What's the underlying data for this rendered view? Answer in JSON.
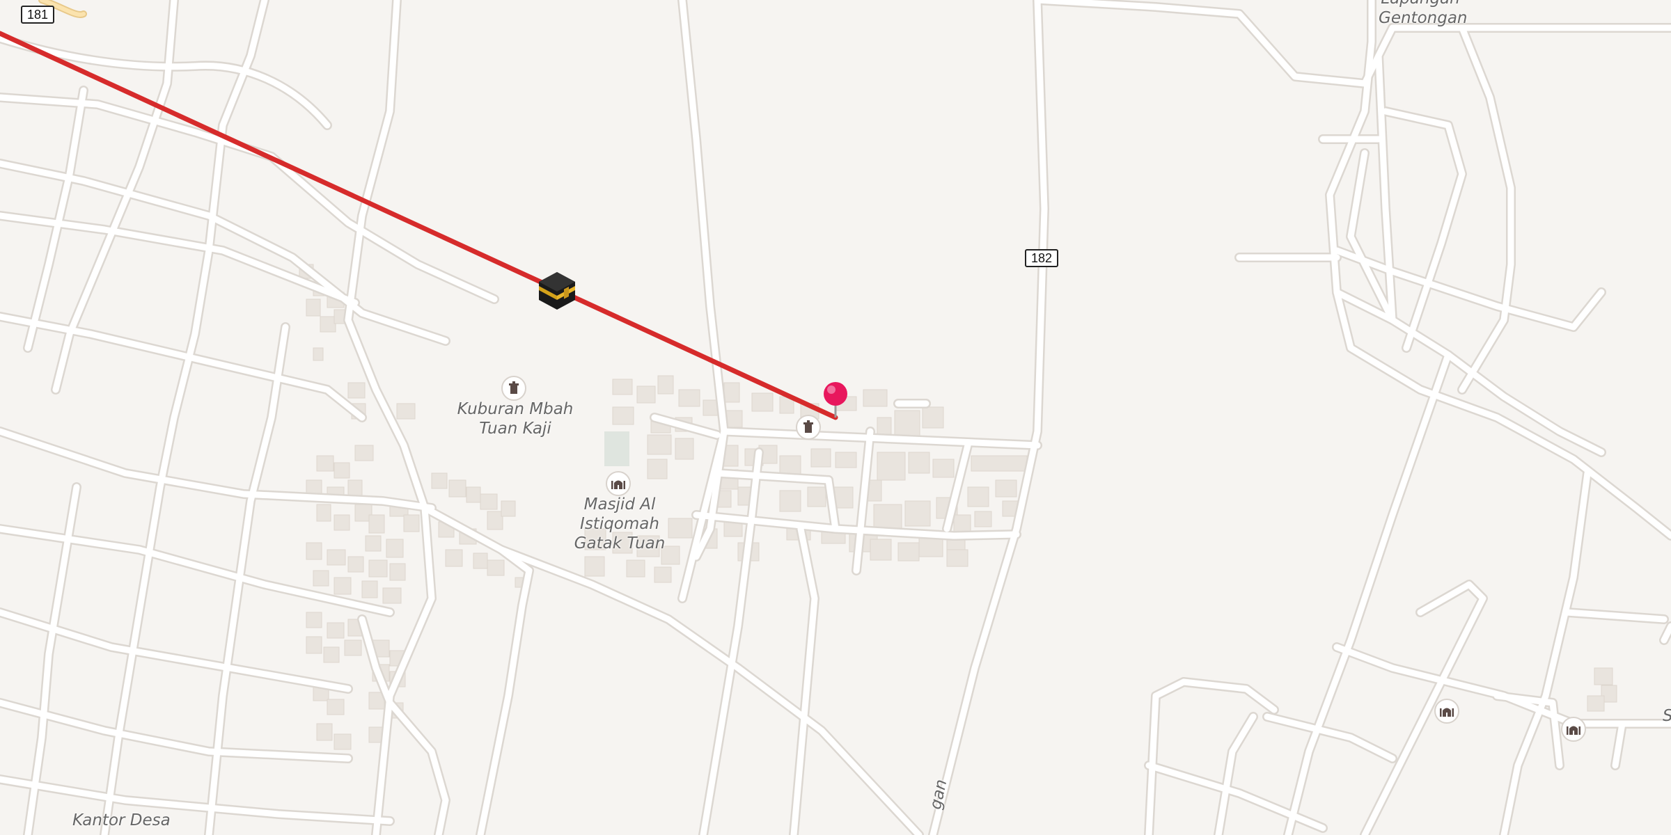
{
  "map": {
    "route_color": "#d62b2b",
    "road_color": "#ffffff",
    "road_casing": "#dedad5",
    "building_color": "#e9e4de",
    "background": "#f6f4f1"
  },
  "shields": [
    {
      "id": "181",
      "text": "181"
    },
    {
      "id": "182",
      "text": "182"
    }
  ],
  "labels": {
    "lapangan": "Lapangan\nGentongan",
    "kuburan": "Kuburan Mbah\nTuan Kaji",
    "masjid": "Masjid Al Istiqomah\nGatak Tuan",
    "kantor": "Kantor Desa",
    "street_partial": "gan",
    "edge_partial": "S"
  },
  "markers": {
    "pin_color": "#e8175d",
    "kaaba_icon": "kaaba-icon",
    "cemetery_icon": "cemetery-icon",
    "mosque_icon": "mosque-icon"
  }
}
